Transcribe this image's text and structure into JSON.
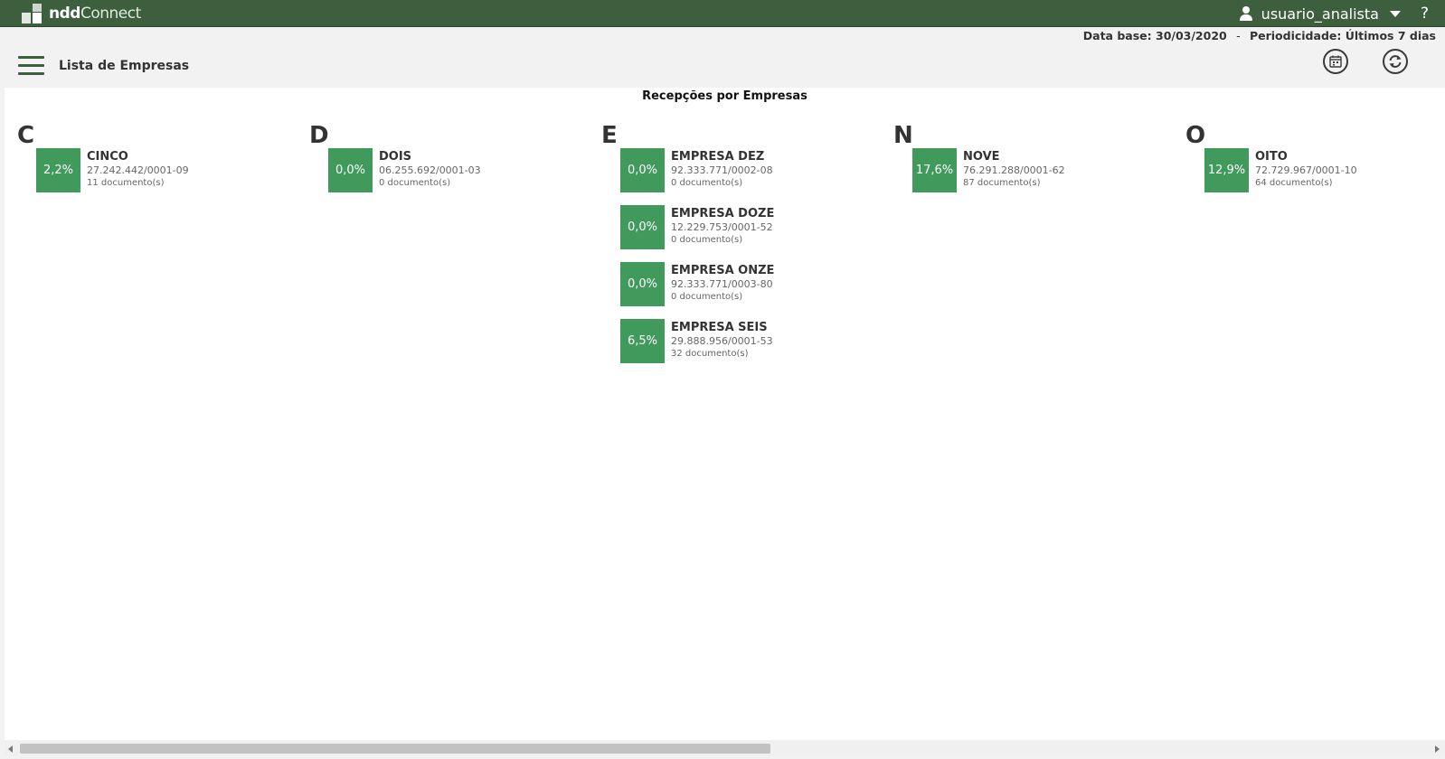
{
  "header": {
    "brand_bold": "ndd",
    "brand_rest": "Connect",
    "username": "usuario_analista",
    "help": "?"
  },
  "filters": {
    "data_base_label": "Data base:",
    "data_base_value": "30/03/2020",
    "separator": "-",
    "periodicity_label": "Periodicidade:",
    "periodicity_value": "Últimos 7 dias"
  },
  "page": {
    "title": "Lista de Empresas"
  },
  "panel": {
    "title": "Recepções por Empresas"
  },
  "groups": [
    {
      "letter": "C",
      "companies": [
        {
          "percent": "2,2%",
          "name": "CINCO",
          "cnpj": "27.242.442/0001-09",
          "docs": "11 documento(s)"
        }
      ]
    },
    {
      "letter": "D",
      "companies": [
        {
          "percent": "0,0%",
          "name": "DOIS",
          "cnpj": "06.255.692/0001-03",
          "docs": "0 documento(s)"
        }
      ]
    },
    {
      "letter": "E",
      "companies": [
        {
          "percent": "0,0%",
          "name": "EMPRESA DEZ",
          "cnpj": "92.333.771/0002-08",
          "docs": "0 documento(s)"
        },
        {
          "percent": "0,0%",
          "name": "EMPRESA DOZE",
          "cnpj": "12.229.753/0001-52",
          "docs": "0 documento(s)"
        },
        {
          "percent": "0,0%",
          "name": "EMPRESA ONZE",
          "cnpj": "92.333.771/0003-80",
          "docs": "0 documento(s)"
        },
        {
          "percent": "6,5%",
          "name": "EMPRESA SEIS",
          "cnpj": "29.888.956/0001-53",
          "docs": "32 documento(s)"
        }
      ]
    },
    {
      "letter": "N",
      "companies": [
        {
          "percent": "17,6%",
          "name": "NOVE",
          "cnpj": "76.291.288/0001-62",
          "docs": "87 documento(s)"
        }
      ]
    },
    {
      "letter": "O",
      "companies": [
        {
          "percent": "12,9%",
          "name": "OITO",
          "cnpj": "72.729.967/0001-10",
          "docs": "64 documento(s)"
        }
      ]
    }
  ],
  "colors": {
    "header_bg": "#3d5f3e",
    "tile_bg": "#3f9a5b"
  },
  "icons": {
    "menu": "hamburger-menu-icon",
    "user": "user-icon",
    "dropdown": "chevron-down-icon",
    "calendar": "calendar-icon",
    "refresh": "refresh-icon"
  }
}
